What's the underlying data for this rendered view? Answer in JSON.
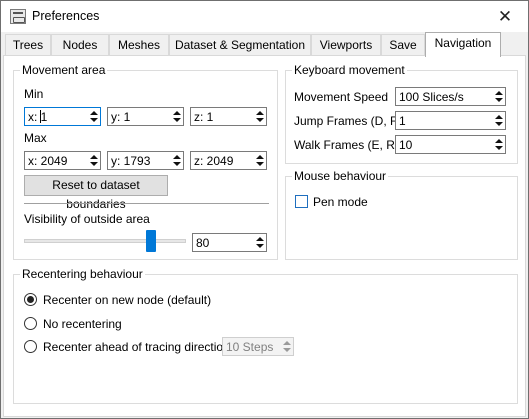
{
  "window": {
    "title": "Preferences",
    "close_symbol": "✕"
  },
  "tabs": [
    {
      "label": "Trees"
    },
    {
      "label": "Nodes"
    },
    {
      "label": "Meshes"
    },
    {
      "label": "Dataset & Segmentation"
    },
    {
      "label": "Viewports"
    },
    {
      "label": "Save"
    },
    {
      "label": "Navigation"
    }
  ],
  "active_tab": "Navigation",
  "movement_area": {
    "title": "Movement area",
    "min_label": "Min",
    "max_label": "Max",
    "min": {
      "x": "x: 1",
      "y": "y: 1",
      "z": "z: 1"
    },
    "max": {
      "x": "x: 2049",
      "y": "y: 1793",
      "z": "z: 2049"
    },
    "reset_button": "Reset to dataset boundaries",
    "visibility_label": "Visibility of outside area",
    "visibility_value": "80",
    "visibility_fraction": 0.8
  },
  "keyboard_movement": {
    "title": "Keyboard movement",
    "speed_label": "Movement Speed",
    "speed_value": "100 Slices/s",
    "jump_label": "Jump Frames (D, F)",
    "jump_value": "1",
    "walk_label": "Walk Frames (E, R)",
    "walk_value": "10"
  },
  "mouse_behaviour": {
    "title": "Mouse behaviour",
    "pen_mode_label": "Pen mode",
    "pen_mode_checked": false
  },
  "recentering": {
    "title": "Recentering behaviour",
    "options": [
      {
        "label": "Recenter on new node (default)",
        "checked": true
      },
      {
        "label": "No recentering",
        "checked": false
      },
      {
        "label": "Recenter ahead of tracing direction",
        "checked": false
      }
    ],
    "steps_value": "10 Steps"
  }
}
